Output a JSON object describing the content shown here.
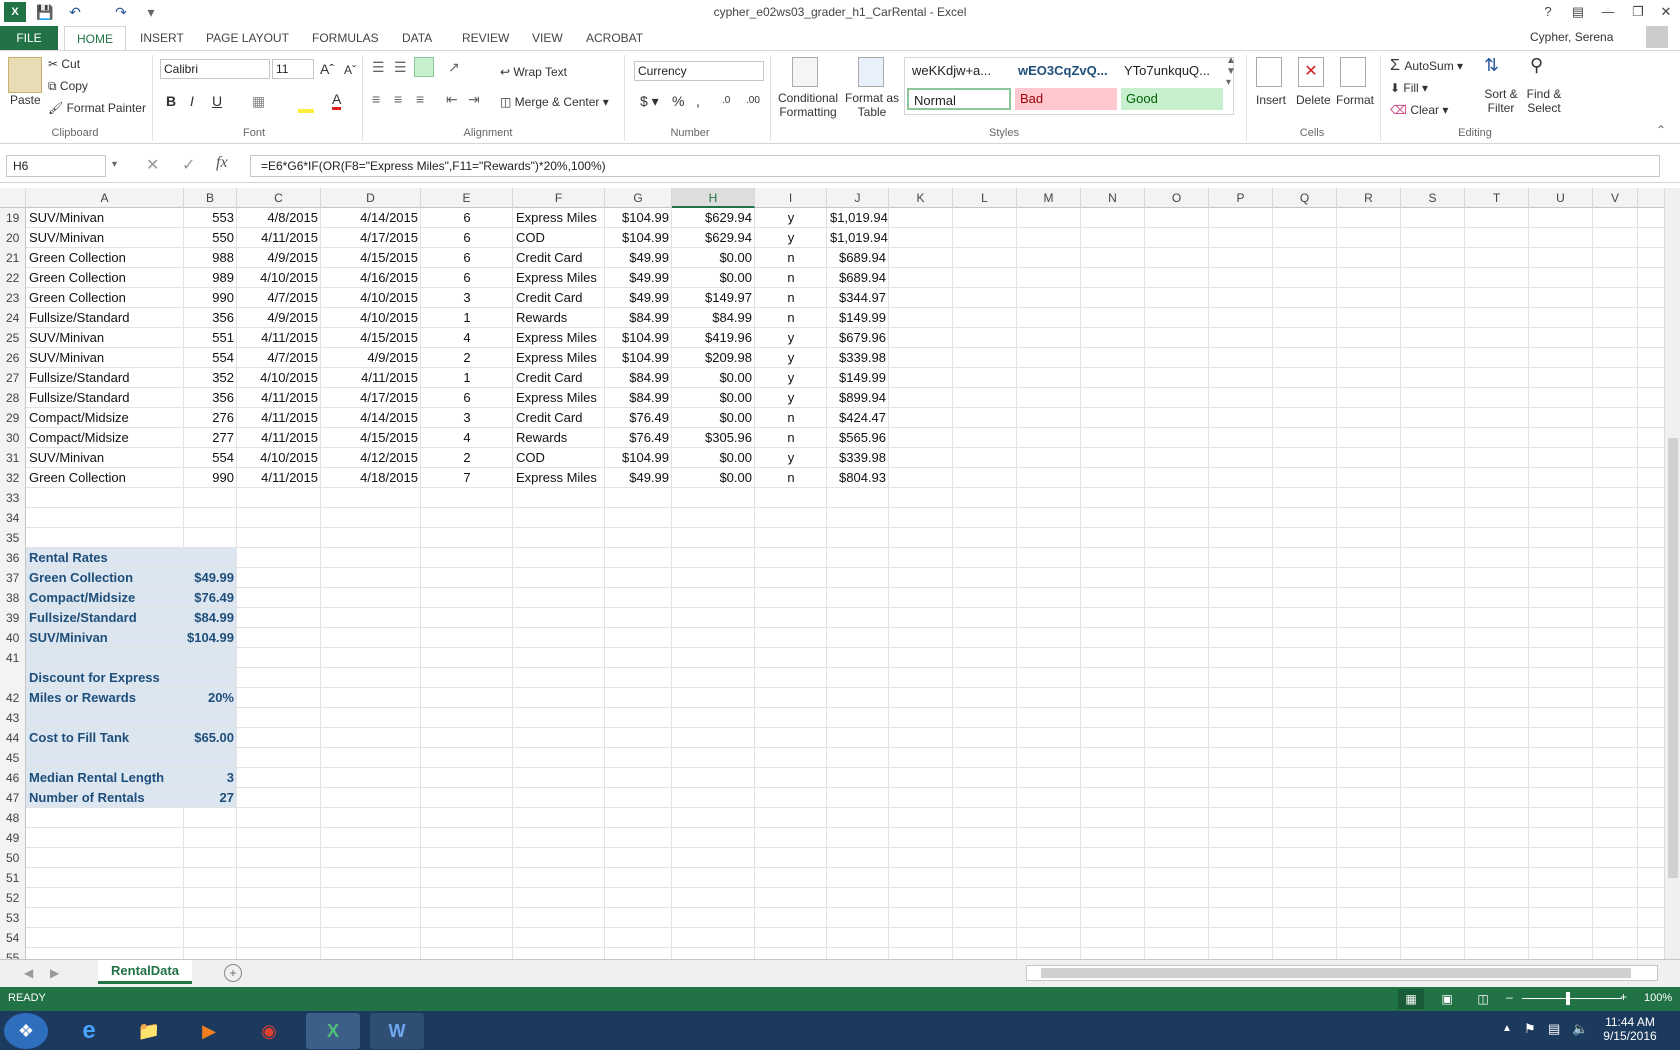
{
  "window": {
    "title": "cypher_e02ws03_grader_h1_CarRental - Excel",
    "user": "Cypher, Serena"
  },
  "tabs": [
    "FILE",
    "HOME",
    "INSERT",
    "PAGE LAYOUT",
    "FORMULAS",
    "DATA",
    "REVIEW",
    "VIEW",
    "ACROBAT"
  ],
  "ribbon": {
    "clipboard": {
      "paste": "Paste",
      "cut": "Cut",
      "copy": "Copy",
      "format_painter": "Format Painter",
      "label": "Clipboard"
    },
    "font": {
      "name": "Calibri",
      "size": "11",
      "label": "Font"
    },
    "alignment": {
      "wrap": "Wrap Text",
      "merge": "Merge & Center",
      "label": "Alignment"
    },
    "number": {
      "format": "Currency",
      "label": "Number"
    },
    "styles": {
      "cond1": "Conditional",
      "cond2": "Formatting",
      "fmt1": "Format as",
      "fmt2": "Table",
      "s1": "weKKdjw+a...",
      "s2": "wEO3CqZvQ...",
      "s3": "YTo7unkquQ...",
      "normal": "Normal",
      "bad": "Bad",
      "good": "Good",
      "label": "Styles"
    },
    "cells": {
      "insert": "Insert",
      "delete": "Delete",
      "format": "Format",
      "label": "Cells"
    },
    "editing": {
      "autosum": "AutoSum",
      "fill": "Fill",
      "clear": "Clear",
      "sort1": "Sort &",
      "sort2": "Filter",
      "find1": "Find &",
      "find2": "Select",
      "label": "Editing"
    }
  },
  "formula_bar": {
    "name_box": "H6",
    "formula": "=E6*G6*IF(OR(F8=\"Express Miles\",F11=\"Rewards\")*20%,100%)"
  },
  "columns": [
    "A",
    "B",
    "C",
    "D",
    "E",
    "F",
    "G",
    "H",
    "I",
    "J",
    "K",
    "L",
    "M",
    "N",
    "O",
    "P",
    "Q",
    "R",
    "S",
    "T",
    "U",
    "V"
  ],
  "rows": [
    {
      "n": "19",
      "A": "SUV/Minivan",
      "B": "553",
      "C": "4/8/2015",
      "D": "4/14/2015",
      "E": "6",
      "F": "Express Miles",
      "G": "$104.99",
      "H": "$629.94",
      "I": "y",
      "J": "$1,019.94"
    },
    {
      "n": "20",
      "A": "SUV/Minivan",
      "B": "550",
      "C": "4/11/2015",
      "D": "4/17/2015",
      "E": "6",
      "F": "COD",
      "G": "$104.99",
      "H": "$629.94",
      "I": "y",
      "J": "$1,019.94"
    },
    {
      "n": "21",
      "A": "Green Collection",
      "B": "988",
      "C": "4/9/2015",
      "D": "4/15/2015",
      "E": "6",
      "F": "Credit Card",
      "G": "$49.99",
      "H": "$0.00",
      "I": "n",
      "J": "$689.94"
    },
    {
      "n": "22",
      "A": "Green Collection",
      "B": "989",
      "C": "4/10/2015",
      "D": "4/16/2015",
      "E": "6",
      "F": "Express Miles",
      "G": "$49.99",
      "H": "$0.00",
      "I": "n",
      "J": "$689.94"
    },
    {
      "n": "23",
      "A": "Green Collection",
      "B": "990",
      "C": "4/7/2015",
      "D": "4/10/2015",
      "E": "3",
      "F": "Credit Card",
      "G": "$49.99",
      "H": "$149.97",
      "I": "n",
      "J": "$344.97"
    },
    {
      "n": "24",
      "A": "Fullsize/Standard",
      "B": "356",
      "C": "4/9/2015",
      "D": "4/10/2015",
      "E": "1",
      "F": "Rewards",
      "G": "$84.99",
      "H": "$84.99",
      "I": "n",
      "J": "$149.99"
    },
    {
      "n": "25",
      "A": "SUV/Minivan",
      "B": "551",
      "C": "4/11/2015",
      "D": "4/15/2015",
      "E": "4",
      "F": "Express Miles",
      "G": "$104.99",
      "H": "$419.96",
      "I": "y",
      "J": "$679.96"
    },
    {
      "n": "26",
      "A": "SUV/Minivan",
      "B": "554",
      "C": "4/7/2015",
      "D": "4/9/2015",
      "E": "2",
      "F": "Express Miles",
      "G": "$104.99",
      "H": "$209.98",
      "I": "y",
      "J": "$339.98"
    },
    {
      "n": "27",
      "A": "Fullsize/Standard",
      "B": "352",
      "C": "4/10/2015",
      "D": "4/11/2015",
      "E": "1",
      "F": "Credit Card",
      "G": "$84.99",
      "H": "$0.00",
      "I": "y",
      "J": "$149.99"
    },
    {
      "n": "28",
      "A": "Fullsize/Standard",
      "B": "356",
      "C": "4/11/2015",
      "D": "4/17/2015",
      "E": "6",
      "F": "Express Miles",
      "G": "$84.99",
      "H": "$0.00",
      "I": "y",
      "J": "$899.94"
    },
    {
      "n": "29",
      "A": "Compact/Midsize",
      "B": "276",
      "C": "4/11/2015",
      "D": "4/14/2015",
      "E": "3",
      "F": "Credit Card",
      "G": "$76.49",
      "H": "$0.00",
      "I": "n",
      "J": "$424.47"
    },
    {
      "n": "30",
      "A": "Compact/Midsize",
      "B": "277",
      "C": "4/11/2015",
      "D": "4/15/2015",
      "E": "4",
      "F": "Rewards",
      "G": "$76.49",
      "H": "$305.96",
      "I": "n",
      "J": "$565.96"
    },
    {
      "n": "31",
      "A": "SUV/Minivan",
      "B": "554",
      "C": "4/10/2015",
      "D": "4/12/2015",
      "E": "2",
      "F": "COD",
      "G": "$104.99",
      "H": "$0.00",
      "I": "y",
      "J": "$339.98"
    },
    {
      "n": "32",
      "A": "Green Collection",
      "B": "990",
      "C": "4/11/2015",
      "D": "4/18/2015",
      "E": "7",
      "F": "Express Miles",
      "G": "$49.99",
      "H": "$0.00",
      "I": "n",
      "J": "$804.93"
    },
    {
      "n": "33"
    },
    {
      "n": "34"
    },
    {
      "n": "35"
    },
    {
      "n": "36",
      "A": "Rental Rates",
      "blue": true
    },
    {
      "n": "37",
      "A": "Green Collection",
      "B": "$49.99",
      "blue": true
    },
    {
      "n": "38",
      "A": "Compact/Midsize",
      "B": "$76.49",
      "blue": true
    },
    {
      "n": "39",
      "A": "Fullsize/Standard",
      "B": "$84.99",
      "blue": true
    },
    {
      "n": "40",
      "A": "SUV/Minivan",
      "B": "$104.99",
      "blue": true
    },
    {
      "n": "41",
      "blue": true
    },
    {
      "n": "",
      "A": "Discount for Express",
      "blue": true
    },
    {
      "n": "42",
      "A": "Miles or Rewards",
      "B": "20%",
      "blue": true
    },
    {
      "n": "43",
      "blue": true
    },
    {
      "n": "44",
      "A": "Cost to Fill Tank",
      "B": "$65.00",
      "blue": true
    },
    {
      "n": "45",
      "blue": true
    },
    {
      "n": "46",
      "A": "Median Rental Length",
      "B": "3",
      "blue": true
    },
    {
      "n": "47",
      "A": "Number of Rentals",
      "B": "27",
      "blue": true
    },
    {
      "n": "48"
    },
    {
      "n": "49"
    },
    {
      "n": "50"
    },
    {
      "n": "51"
    },
    {
      "n": "52"
    },
    {
      "n": "53"
    },
    {
      "n": "54"
    },
    {
      "n": "55"
    }
  ],
  "sheet_tab": "RentalData",
  "status": {
    "ready": "READY",
    "zoom": "100%"
  },
  "taskbar": {
    "time": "11:44 AM",
    "date": "9/15/2016"
  }
}
